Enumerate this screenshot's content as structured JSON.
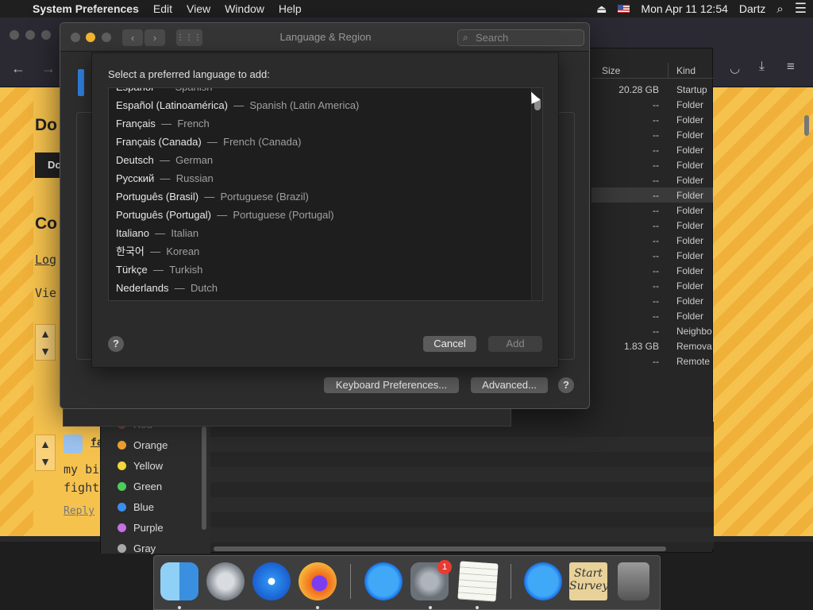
{
  "menubar": {
    "app": "System Preferences",
    "items": [
      "Edit",
      "View",
      "Window",
      "Help"
    ],
    "clock": "Mon Apr 11  12:54",
    "user": "Dartz"
  },
  "browser": {
    "page_texts": [
      "Do",
      "Do",
      "Co",
      "Log",
      "Vie",
      "my bi",
      "fight",
      "Reply",
      "fa"
    ]
  },
  "finder": {
    "columns": {
      "size": "Size",
      "kind": "Kind"
    },
    "rows": [
      {
        "size": "20.28 GB",
        "kind": "Startup"
      },
      {
        "size": "--",
        "kind": "Folder"
      },
      {
        "size": "--",
        "kind": "Folder"
      },
      {
        "size": "--",
        "kind": "Folder"
      },
      {
        "size": "--",
        "kind": "Folder"
      },
      {
        "size": "--",
        "kind": "Folder"
      },
      {
        "size": "--",
        "kind": "Folder"
      },
      {
        "size": "--",
        "kind": "Folder"
      },
      {
        "size": "--",
        "kind": "Folder"
      },
      {
        "size": "--",
        "kind": "Folder"
      },
      {
        "size": "--",
        "kind": "Folder"
      },
      {
        "size": "--",
        "kind": "Folder"
      },
      {
        "size": "--",
        "kind": "Folder"
      },
      {
        "size": "--",
        "kind": "Folder"
      },
      {
        "size": "--",
        "kind": "Folder"
      },
      {
        "size": "--",
        "kind": "Folder"
      },
      {
        "size": "--",
        "kind": "Neighbo"
      },
      {
        "size": "1.83 GB",
        "kind": "Remova"
      },
      {
        "size": "--",
        "kind": "Remote"
      }
    ],
    "tags": [
      {
        "name": "Red",
        "color": "#e05a55"
      },
      {
        "name": "Orange",
        "color": "#f0a030"
      },
      {
        "name": "Yellow",
        "color": "#f2d63a"
      },
      {
        "name": "Green",
        "color": "#4ccc5a"
      },
      {
        "name": "Blue",
        "color": "#3a8ef0"
      },
      {
        "name": "Purple",
        "color": "#c66fe6"
      },
      {
        "name": "Gray",
        "color": "#a8a8a8"
      }
    ]
  },
  "prefs": {
    "title": "Language & Region",
    "search_placeholder": "Search",
    "keyboard_button": "Keyboard Preferences...",
    "advanced_button": "Advanced...",
    "help": "?"
  },
  "sheet": {
    "prompt": "Select a preferred language to add:",
    "languages": [
      {
        "native": "Español",
        "english": "Spanish"
      },
      {
        "native": "Español (Latinoamérica)",
        "english": "Spanish (Latin America)"
      },
      {
        "native": "Français",
        "english": "French"
      },
      {
        "native": "Français (Canada)",
        "english": "French (Canada)"
      },
      {
        "native": "Deutsch",
        "english": "German"
      },
      {
        "native": "Русский",
        "english": "Russian"
      },
      {
        "native": "Português (Brasil)",
        "english": "Portuguese (Brazil)"
      },
      {
        "native": "Português (Portugal)",
        "english": "Portuguese (Portugal)"
      },
      {
        "native": "Italiano",
        "english": "Italian"
      },
      {
        "native": "한국어",
        "english": "Korean"
      },
      {
        "native": "Türkçe",
        "english": "Turkish"
      },
      {
        "native": "Nederlands",
        "english": "Dutch"
      }
    ],
    "separator": "—",
    "cancel_button": "Cancel",
    "add_button": "Add",
    "help": "?"
  },
  "dock": {
    "badge": "1",
    "survey_label": "Start Survey"
  }
}
